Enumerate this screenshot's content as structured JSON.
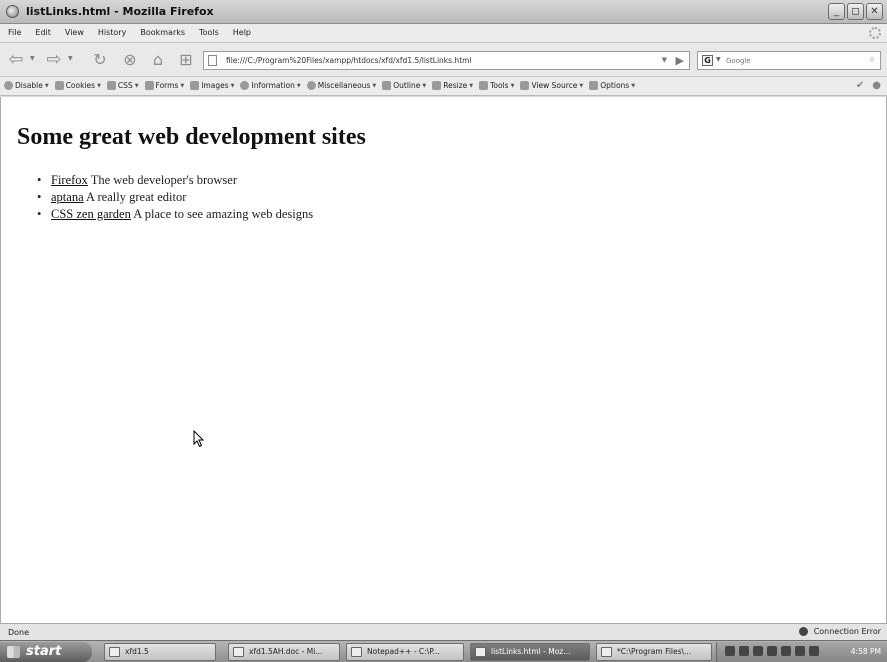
{
  "window": {
    "title": "listLinks.html - Mozilla Firefox",
    "controls": [
      "_",
      "◻",
      "✕"
    ]
  },
  "menu": [
    "File",
    "Edit",
    "View",
    "History",
    "Bookmarks",
    "Tools",
    "Help"
  ],
  "nav": {
    "url": "file:///C:/Program%20Files/xampp/htdocs/xfd/xfd1.5/listLinks.html",
    "search_placeholder": "Google",
    "search_engine_glyph": "G",
    "icons": [
      "back-icon",
      "forward-icon",
      "reload-icon",
      "stop-icon",
      "home-icon",
      "new-tab-icon"
    ]
  },
  "devtoolbar": {
    "items": [
      "Disable",
      "Cookies",
      "CSS",
      "Forms",
      "Images",
      "Information",
      "Miscellaneous",
      "Outline",
      "Resize",
      "Tools",
      "View Source",
      "Options"
    ]
  },
  "page": {
    "heading": "Some great web development sites",
    "links": [
      {
        "text": "Firefox",
        "desc": " The web developer's browser"
      },
      {
        "text": "aptana",
        "desc": " A really great editor"
      },
      {
        "text": "CSS zen garden",
        "desc": " A place to see amazing web designs"
      }
    ]
  },
  "status": {
    "left": "Done",
    "right": "Connection Error"
  },
  "taskbar": {
    "start": "start",
    "tasks": [
      {
        "label": "xfd1.5"
      },
      {
        "label": "xfd1.5AH.doc - Mi..."
      },
      {
        "label": "Notepad++ - C:\\P..."
      },
      {
        "label": "listLinks.html - Moz..."
      },
      {
        "label": "*C:\\Program Files\\..."
      }
    ],
    "clock": "4:58 PM"
  },
  "colors": {
    "content_bg": "#ffffff",
    "chrome_bg": "#e9e9e9",
    "taskbar_bg": "#8f8f8f"
  }
}
